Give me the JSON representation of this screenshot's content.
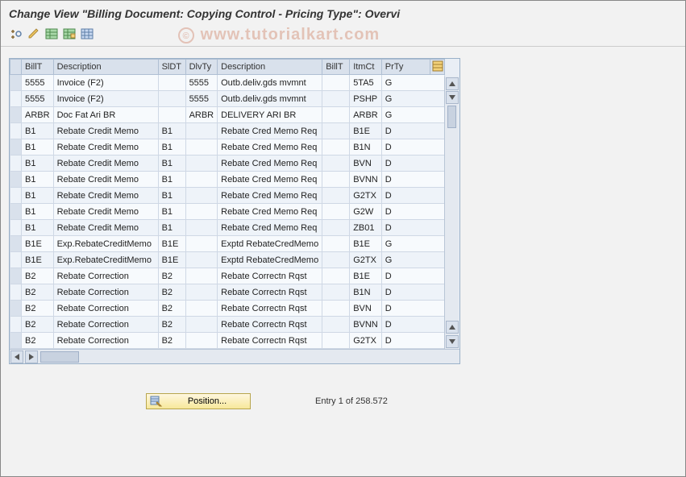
{
  "title": "Change View \"Billing Document: Copying Control - Pricing Type\": Overvi",
  "watermark": "www.tutorialkart.com",
  "toolbar": {
    "icons": [
      "toggle-icon",
      "pencil-icon",
      "table-icon",
      "table2-icon",
      "grid-icon"
    ]
  },
  "columns": [
    "BillT",
    "Description",
    "SlDT",
    "DlvTy",
    "Description",
    "BillT",
    "ItmCt",
    "PrTy"
  ],
  "rows": [
    {
      "billt": "5555",
      "desc": "Invoice (F2)",
      "sldt": "",
      "dlvty": "5555",
      "desc2": "Outb.deliv.gds mvmnt",
      "billt2": "",
      "itmct": "5TA5",
      "prty": "G"
    },
    {
      "billt": "5555",
      "desc": "Invoice (F2)",
      "sldt": "",
      "dlvty": "5555",
      "desc2": "Outb.deliv.gds mvmnt",
      "billt2": "",
      "itmct": "PSHP",
      "prty": "G"
    },
    {
      "billt": "ARBR",
      "desc": "Doc Fat Ari BR",
      "sldt": "",
      "dlvty": "ARBR",
      "desc2": "DELIVERY ARI BR",
      "billt2": "",
      "itmct": "ARBR",
      "prty": "G"
    },
    {
      "billt": "B1",
      "desc": "Rebate Credit Memo",
      "sldt": "B1",
      "dlvty": "",
      "desc2": "Rebate Cred Memo Req",
      "billt2": "",
      "itmct": "B1E",
      "prty": "D"
    },
    {
      "billt": "B1",
      "desc": "Rebate Credit Memo",
      "sldt": "B1",
      "dlvty": "",
      "desc2": "Rebate Cred Memo Req",
      "billt2": "",
      "itmct": "B1N",
      "prty": "D"
    },
    {
      "billt": "B1",
      "desc": "Rebate Credit Memo",
      "sldt": "B1",
      "dlvty": "",
      "desc2": "Rebate Cred Memo Req",
      "billt2": "",
      "itmct": "BVN",
      "prty": "D"
    },
    {
      "billt": "B1",
      "desc": "Rebate Credit Memo",
      "sldt": "B1",
      "dlvty": "",
      "desc2": "Rebate Cred Memo Req",
      "billt2": "",
      "itmct": "BVNN",
      "prty": "D"
    },
    {
      "billt": "B1",
      "desc": "Rebate Credit Memo",
      "sldt": "B1",
      "dlvty": "",
      "desc2": "Rebate Cred Memo Req",
      "billt2": "",
      "itmct": "G2TX",
      "prty": "D"
    },
    {
      "billt": "B1",
      "desc": "Rebate Credit Memo",
      "sldt": "B1",
      "dlvty": "",
      "desc2": "Rebate Cred Memo Req",
      "billt2": "",
      "itmct": "G2W",
      "prty": "D"
    },
    {
      "billt": "B1",
      "desc": "Rebate Credit Memo",
      "sldt": "B1",
      "dlvty": "",
      "desc2": "Rebate Cred Memo Req",
      "billt2": "",
      "itmct": "ZB01",
      "prty": "D"
    },
    {
      "billt": "B1E",
      "desc": "Exp.RebateCreditMemo",
      "sldt": "B1E",
      "dlvty": "",
      "desc2": "Exptd RebateCredMemo",
      "billt2": "",
      "itmct": "B1E",
      "prty": "G"
    },
    {
      "billt": "B1E",
      "desc": "Exp.RebateCreditMemo",
      "sldt": "B1E",
      "dlvty": "",
      "desc2": "Exptd RebateCredMemo",
      "billt2": "",
      "itmct": "G2TX",
      "prty": "G"
    },
    {
      "billt": "B2",
      "desc": "Rebate Correction",
      "sldt": "B2",
      "dlvty": "",
      "desc2": "Rebate Correctn Rqst",
      "billt2": "",
      "itmct": "B1E",
      "prty": "D"
    },
    {
      "billt": "B2",
      "desc": "Rebate Correction",
      "sldt": "B2",
      "dlvty": "",
      "desc2": "Rebate Correctn Rqst",
      "billt2": "",
      "itmct": "B1N",
      "prty": "D"
    },
    {
      "billt": "B2",
      "desc": "Rebate Correction",
      "sldt": "B2",
      "dlvty": "",
      "desc2": "Rebate Correctn Rqst",
      "billt2": "",
      "itmct": "BVN",
      "prty": "D"
    },
    {
      "billt": "B2",
      "desc": "Rebate Correction",
      "sldt": "B2",
      "dlvty": "",
      "desc2": "Rebate Correctn Rqst",
      "billt2": "",
      "itmct": "BVNN",
      "prty": "D"
    },
    {
      "billt": "B2",
      "desc": "Rebate Correction",
      "sldt": "B2",
      "dlvty": "",
      "desc2": "Rebate Correctn Rqst",
      "billt2": "",
      "itmct": "G2TX",
      "prty": "D"
    }
  ],
  "footer": {
    "position_label": "Position...",
    "entry_label": "Entry 1 of 258.572"
  }
}
